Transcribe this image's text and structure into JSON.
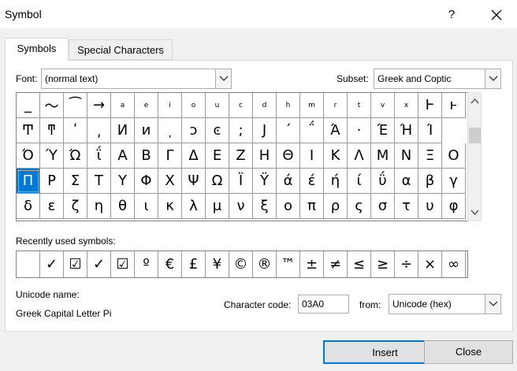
{
  "window": {
    "title": "Symbol",
    "help": "?",
    "close_glyph": "✕"
  },
  "tabs": {
    "symbols": "Symbols",
    "special": "Special Characters"
  },
  "font": {
    "label": "Font:",
    "value": "(normal text)"
  },
  "subset": {
    "label": "Subset:",
    "value": "Greek and Coptic"
  },
  "symbol_grid": {
    "rows": [
      [
        "_",
        "〜",
        "⁀",
        "→",
        "a",
        "e",
        "i",
        "o",
        "u",
        "c",
        "d",
        "h",
        "m",
        "r",
        "t",
        "v",
        "x",
        "Ͱ",
        "ͱ"
      ],
      [
        "Ͳ",
        "ͳ",
        "ʹ",
        "͵",
        "Ͷ",
        "ͷ",
        "ͺ",
        "ͻ",
        "ͼ",
        ";",
        "Ϳ",
        "΄",
        "΅",
        "Ά",
        "·",
        "Έ",
        "Ή",
        "Ί"
      ],
      [
        "Ό",
        "Ύ",
        "Ώ",
        "ΐ",
        "Α",
        "Β",
        "Γ",
        "Δ",
        "Ε",
        "Ζ",
        "Η",
        "Θ",
        "Ι",
        "Κ",
        "Λ",
        "Μ",
        "Ν",
        "Ξ",
        "Ο"
      ],
      [
        "Π",
        "Ρ",
        "Σ",
        "Τ",
        "Υ",
        "Φ",
        "Χ",
        "Ψ",
        "Ω",
        "Ϊ",
        "Ϋ",
        "ά",
        "έ",
        "ή",
        "ί",
        "ΰ",
        "α",
        "β",
        "γ"
      ],
      [
        "δ",
        "ε",
        "ζ",
        "η",
        "θ",
        "ι",
        "κ",
        "λ",
        "μ",
        "ν",
        "ξ",
        "ο",
        "π",
        "ρ",
        "ς",
        "σ",
        "τ",
        "υ",
        "φ"
      ]
    ],
    "selected": {
      "row": 3,
      "col": 0
    }
  },
  "recent": {
    "label": "Recently used symbols:",
    "items": [
      "",
      "✓",
      "☑",
      "✓",
      "☑",
      "º",
      "€",
      "£",
      "¥",
      "©",
      "®",
      "™",
      "±",
      "≠",
      "≤",
      "≥",
      "÷",
      "×",
      "∞"
    ]
  },
  "unicode_name": {
    "label": "Unicode name:",
    "value": "Greek Capital Letter Pi"
  },
  "char_code": {
    "label": "Character code:",
    "value": "03A0"
  },
  "from": {
    "label": "from:",
    "value": "Unicode (hex)"
  },
  "buttons": {
    "insert": "Insert",
    "close": "Close"
  }
}
